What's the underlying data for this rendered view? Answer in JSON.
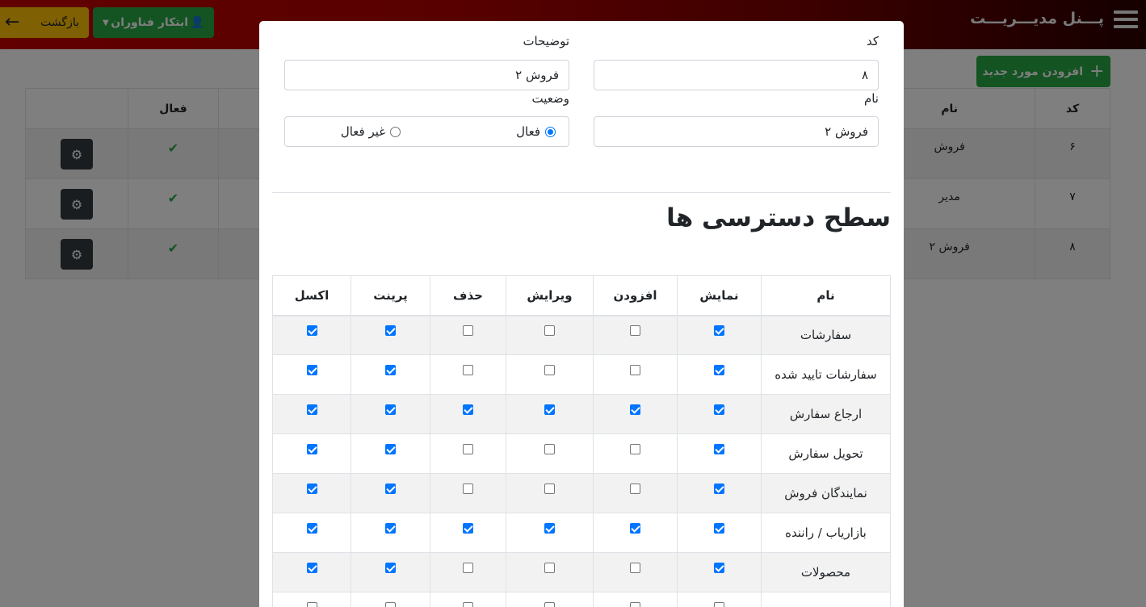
{
  "header": {
    "brand": "پـــنل مدیـــریـــت",
    "back_label": "بازگشت",
    "user_label": "ابتکار فناوران",
    "icons": {
      "menu": "hamburger-icon",
      "back": "arrow-left-icon",
      "user": "user-icon",
      "caret": "caret-down-icon"
    },
    "colors": {
      "bar_start": "#c40000",
      "back": "#ffc107",
      "user": "#28a745"
    }
  },
  "page": {
    "add_label": "افزودن مورد جدید",
    "table": {
      "headers": [
        "کد",
        "نام",
        "",
        "فعال",
        ""
      ],
      "rows": [
        {
          "code": "۶",
          "name": "فروش"
        },
        {
          "code": "۷",
          "name": "مدیر"
        },
        {
          "code": "۸",
          "name": "فروش ۲"
        }
      ]
    }
  },
  "modal": {
    "code_label": "کد",
    "code_value": "۸",
    "desc_label": "توضیحات",
    "desc_value": "فروش ۲",
    "name_label": "نام",
    "name_value": "فروش ۲",
    "status_label": "وضعیت",
    "status_active": "فعال",
    "status_inactive": "غیر فعال",
    "status_selected": "فعال",
    "access_title": "سطح دسترسی ها",
    "perm_headers": [
      "نام",
      "نمایش",
      "افزودن",
      "ویرایش",
      "حذف",
      "پرینت",
      "اکسل"
    ],
    "perm_rows": [
      {
        "name": "سفارشات",
        "checks": [
          true,
          false,
          false,
          false,
          true,
          true
        ]
      },
      {
        "name": "سفارشات تایید شده",
        "checks": [
          true,
          false,
          false,
          false,
          true,
          true
        ]
      },
      {
        "name": "ارجاع سفارش",
        "checks": [
          true,
          true,
          true,
          true,
          true,
          true
        ]
      },
      {
        "name": "تحویل سفارش",
        "checks": [
          true,
          false,
          false,
          false,
          true,
          true
        ]
      },
      {
        "name": "نمایندگان فروش",
        "checks": [
          true,
          false,
          false,
          false,
          true,
          true
        ]
      },
      {
        "name": "بازاریاب / راننده",
        "checks": [
          true,
          true,
          true,
          true,
          true,
          true
        ]
      },
      {
        "name": "محصولات",
        "checks": [
          true,
          false,
          false,
          false,
          true,
          true
        ]
      },
      {
        "name": "",
        "checks": [
          false,
          false,
          false,
          false,
          false,
          false
        ]
      }
    ]
  }
}
